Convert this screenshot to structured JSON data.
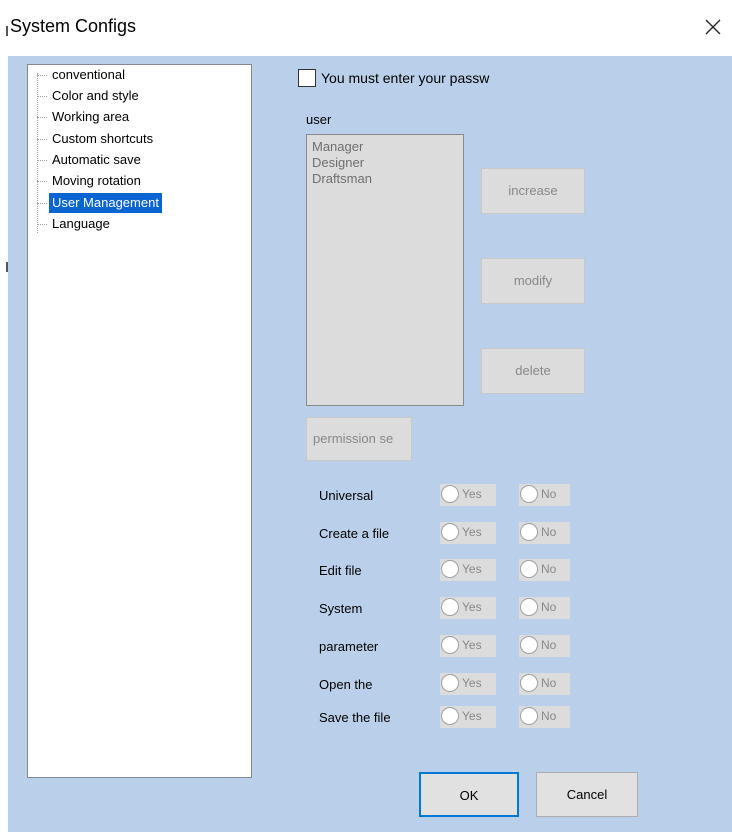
{
  "window": {
    "title": "System Configs"
  },
  "tree": {
    "items": [
      {
        "label": "conventional",
        "selected": false
      },
      {
        "label": "Color and style",
        "selected": false
      },
      {
        "label": "Working area",
        "selected": false
      },
      {
        "label": "Custom shortcuts",
        "selected": false
      },
      {
        "label": "Automatic save",
        "selected": false
      },
      {
        "label": "Moving rotation",
        "selected": false
      },
      {
        "label": "User Management",
        "selected": true
      },
      {
        "label": "Language",
        "selected": false
      }
    ]
  },
  "password": {
    "label": "You must enter your passw",
    "checked": false
  },
  "users": {
    "label": "user",
    "list": [
      "Manager",
      "Designer",
      "Draftsman"
    ],
    "increase_label": "increase",
    "modify_label": "modify",
    "delete_label": "delete"
  },
  "permissions": {
    "button_label": "permission se",
    "yes_label": "Yes",
    "no_label": "No",
    "rows": [
      {
        "label": "Universal"
      },
      {
        "label": "Create a file"
      },
      {
        "label": "Edit file"
      },
      {
        "label": "System"
      },
      {
        "label": "parameter"
      },
      {
        "label": "Open the"
      },
      {
        "label": "Save the file"
      }
    ]
  },
  "footer": {
    "ok_label": "OK",
    "cancel_label": "Cancel"
  },
  "colors": {
    "client_bg": "#bad0ea",
    "selection": "#0a64d2",
    "disabled_bg": "#dcdcdc",
    "ok_border": "#0078d7"
  }
}
